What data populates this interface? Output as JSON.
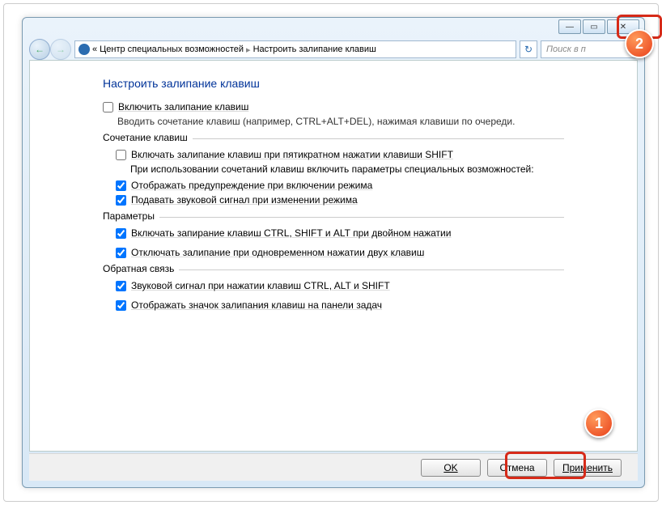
{
  "titlebar": {
    "minimize_glyph": "—",
    "maximize_glyph": "▭",
    "close_glyph": "✕"
  },
  "addrbar": {
    "back_glyph": "←",
    "fwd_glyph": "→",
    "chevron": "«",
    "crumb1": "Центр специальных возможностей",
    "sep": "▸",
    "crumb2": "Настроить залипание клавиш",
    "refresh_glyph": "↻",
    "search_placeholder": "Поиск в п"
  },
  "main": {
    "heading": "Настроить залипание клавиш",
    "enable_label": "Включить залипание клавиш",
    "enable_desc": "Вводить сочетание клавиш (например, CTRL+ALT+DEL), нажимая клавиши по очереди."
  },
  "s1": {
    "title": "Сочетание клавиш",
    "c1": "Включать залипание клавиш при пятикратном нажатии клавиши SHIFT",
    "note": "При использовании сочетаний клавиш включить параметры специальных возможностей:",
    "c2": "Отображать предупреждение при включении режима",
    "c3": "Подавать звуковой сигнал при изменении режима"
  },
  "s2": {
    "title": "Параметры",
    "c1": "Включать запирание клавиш CTRL, SHIFT и ALT при двойном нажатии",
    "c2": "Отключать залипание при одновременном нажатии двух клавиш"
  },
  "s3": {
    "title": "Обратная связь",
    "c1": "Звуковой сигнал при нажатии клавиш CTRL, ALT и SHIFT",
    "c2": "Отображать значок залипания клавиш на панели задач"
  },
  "footer": {
    "ok": "OK",
    "cancel": "Отмена",
    "apply": "Применить"
  },
  "callouts": {
    "one": "1",
    "two": "2"
  }
}
